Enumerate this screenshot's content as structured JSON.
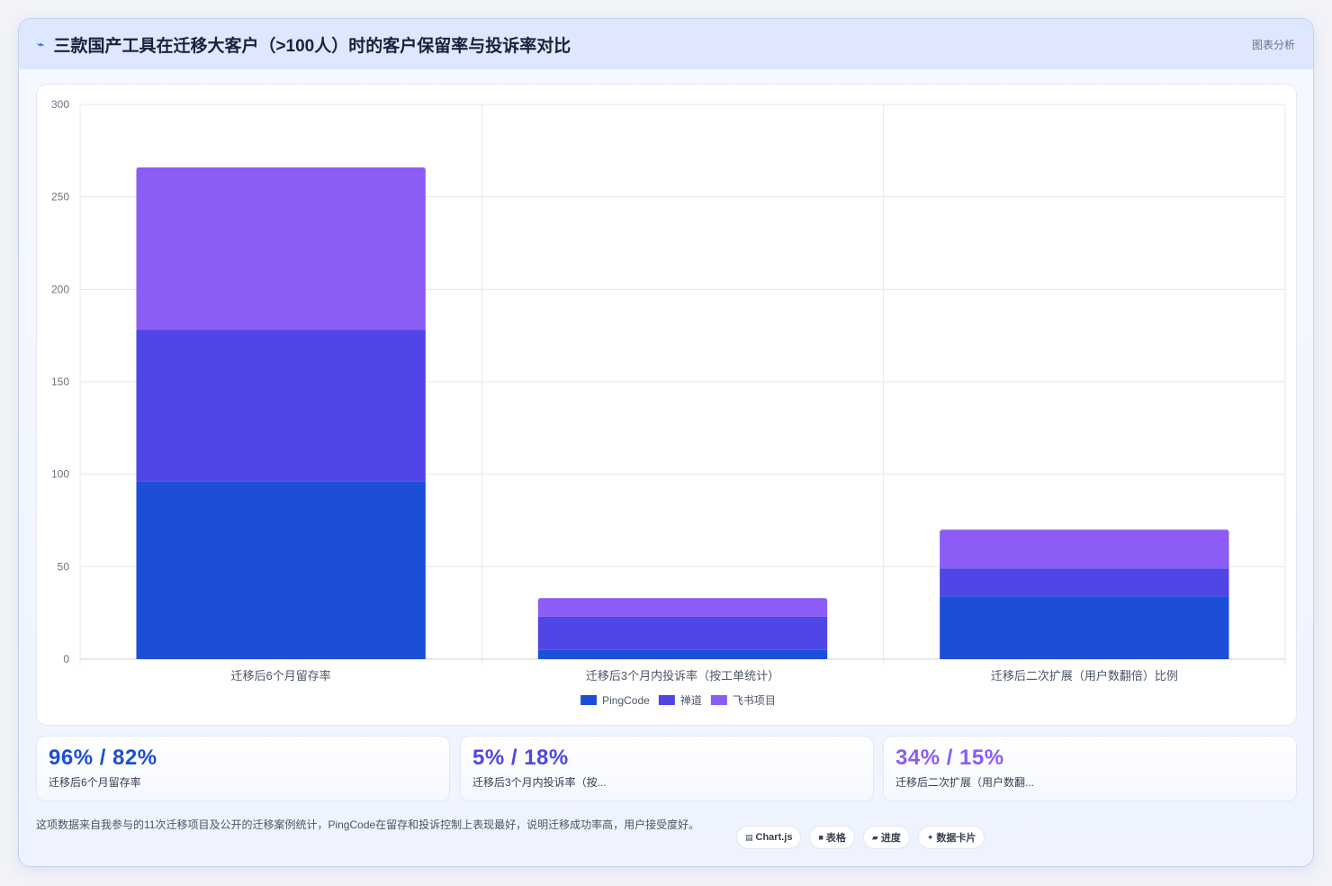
{
  "header": {
    "title": "三款国产工具在迁移大客户（>100人）时的客户保留率与投诉率对比",
    "right_label": "图表分析"
  },
  "chart_data": {
    "type": "bar",
    "stacked": true,
    "categories": [
      "迁移后6个月留存率",
      "迁移后3个月内投诉率（按工单统计）",
      "迁移后二次扩展（用户数翻倍）比例"
    ],
    "series": [
      {
        "name": "PingCode",
        "values": [
          96,
          5,
          34
        ],
        "color": "#1d4ed8"
      },
      {
        "name": "禅道",
        "values": [
          82,
          18,
          15
        ],
        "color": "#4f46e5"
      },
      {
        "name": "飞书项目",
        "values": [
          88,
          10,
          21
        ],
        "color": "#8b5cf6"
      }
    ],
    "ylim": [
      0,
      300
    ],
    "yticks": [
      0,
      50,
      100,
      150,
      200,
      250,
      300
    ],
    "grid": true,
    "legend": "bottom"
  },
  "stats": [
    {
      "value": "96% / 82%",
      "label": "迁移后6个月留存率",
      "color": "#1d4ed8"
    },
    {
      "value": "5% / 18%",
      "label": "迁移后3个月内投诉率（按...",
      "color": "#4f46e5"
    },
    {
      "value": "34% / 15%",
      "label": "迁移后二次扩展（用户数翻...",
      "color": "#8b5cf6"
    }
  ],
  "footer": {
    "note": "这项数据来自我参与的11次迁移项目及公开的迁移案例统计，PingCode在留存和投诉控制上表现最好，说明迁移成功率高，用户接受度好。"
  },
  "chips": [
    {
      "icon": "▤",
      "label": "Chart.js"
    },
    {
      "icon": "■",
      "label": "表格"
    },
    {
      "icon": "▰",
      "label": "进度"
    },
    {
      "icon": "✦",
      "label": "数据卡片"
    }
  ]
}
